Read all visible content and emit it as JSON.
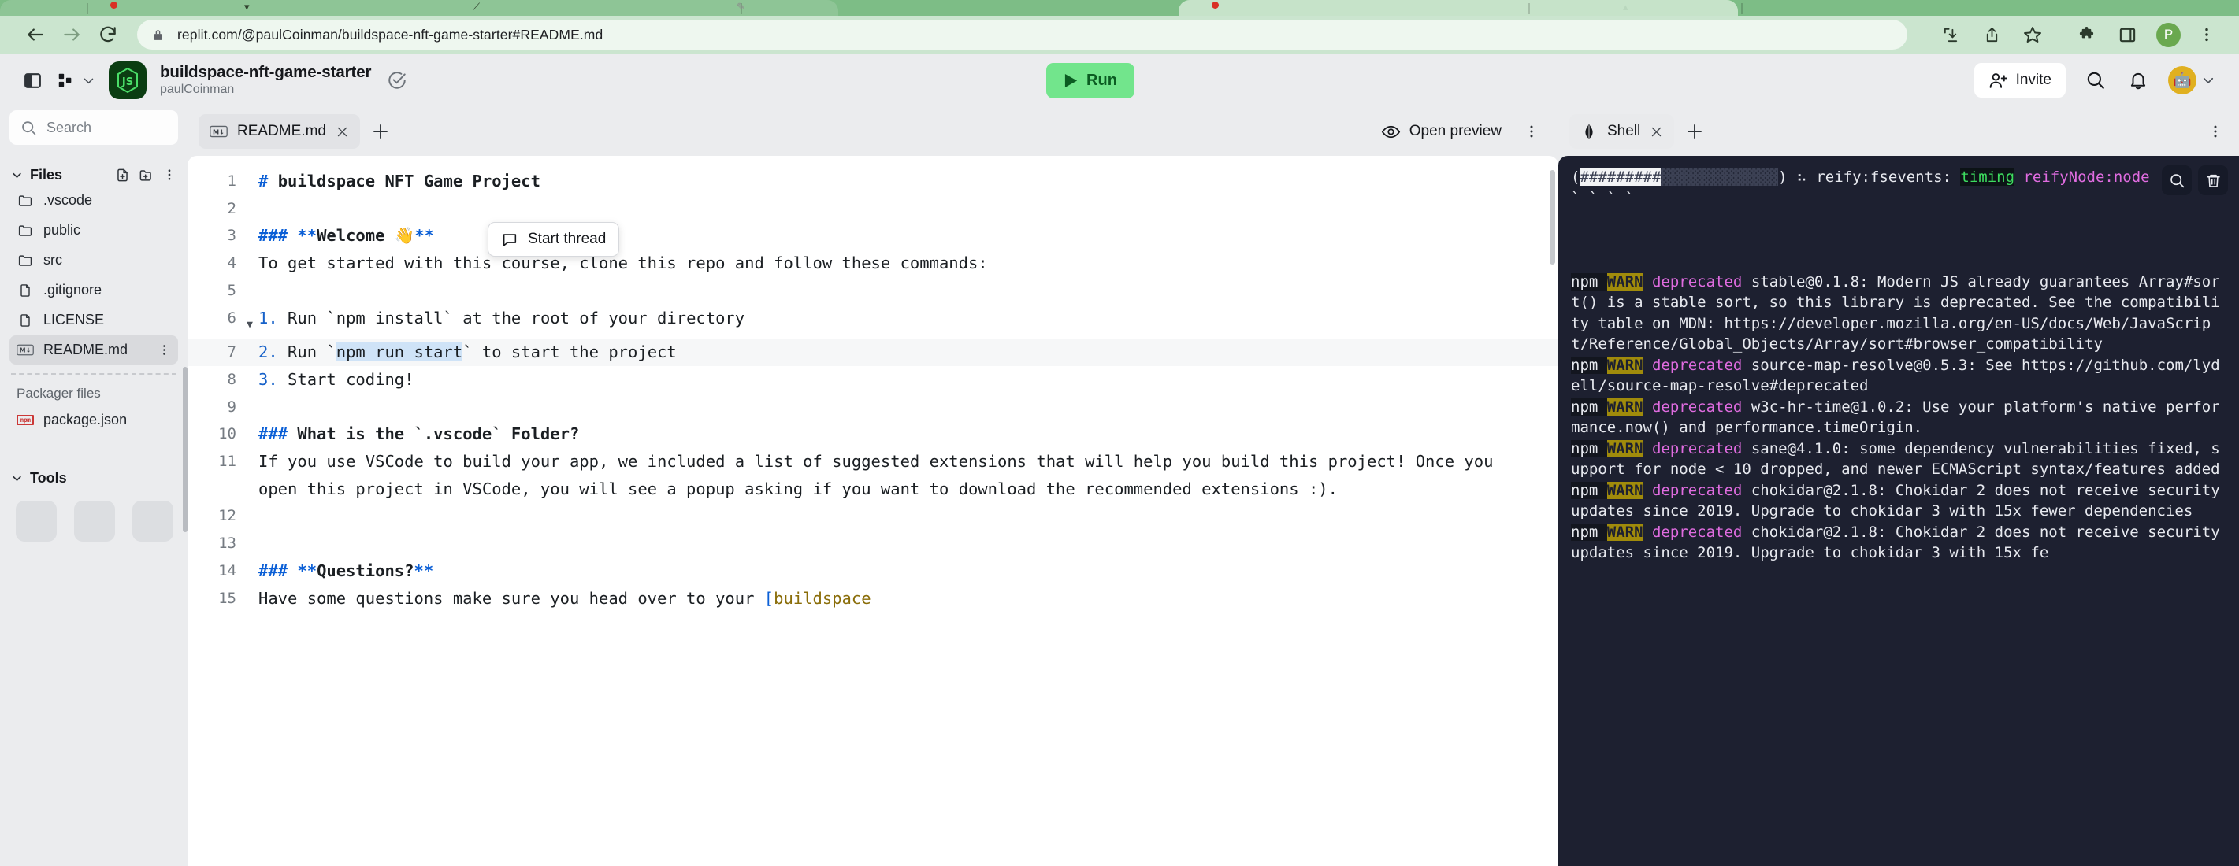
{
  "browser": {
    "url": "replit.com/@paulCoinman/buildspace-nft-game-starter#README.md",
    "nav": {
      "back": "back-arrow",
      "forward": "forward-arrow",
      "reload": "reload"
    },
    "toolbar_icons": [
      "install-icon",
      "share-icon",
      "bookmark-star-icon",
      "extensions-puzzle-icon",
      "side-panel-icon",
      "browser-menu-icon"
    ],
    "profile_initial": "P"
  },
  "header": {
    "project_title": "buildspace-nft-game-starter",
    "project_owner": "paulCoinman",
    "project_badge": "JS",
    "run_label": "Run",
    "invite_label": "Invite",
    "avatar_glyph": "🤖"
  },
  "sidebar": {
    "search_placeholder": "Search",
    "files_title": "Files",
    "files": [
      {
        "name": ".vscode",
        "type": "folder",
        "selected": false
      },
      {
        "name": "public",
        "type": "folder",
        "selected": false
      },
      {
        "name": "src",
        "type": "folder",
        "selected": false
      },
      {
        "name": ".gitignore",
        "type": "file",
        "selected": false
      },
      {
        "name": "LICENSE",
        "type": "file",
        "selected": false
      },
      {
        "name": "README.md",
        "type": "markdown",
        "selected": true
      }
    ],
    "packager_title": "Packager files",
    "packager_files": [
      {
        "name": "package.json",
        "type": "npm"
      }
    ],
    "tools_title": "Tools"
  },
  "editor": {
    "tab_label": "README.md",
    "tab_icon": "markdown-icon",
    "open_preview_label": "Open preview",
    "start_thread_label": "Start thread",
    "lines": [
      {
        "n": "1",
        "fold": false,
        "active": false,
        "segs": [
          {
            "t": "# ",
            "c": "md-hash"
          },
          {
            "t": "buildspace NFT Game Project",
            "c": "md-strong"
          }
        ]
      },
      {
        "n": "2",
        "fold": false,
        "active": false,
        "segs": []
      },
      {
        "n": "3",
        "fold": false,
        "active": false,
        "segs": [
          {
            "t": "### ",
            "c": "md-hash"
          },
          {
            "t": "**",
            "c": "md-star"
          },
          {
            "t": "Welcome ",
            "c": "md-strong"
          },
          {
            "t": "👋",
            "c": ""
          },
          {
            "t": "**",
            "c": "md-star"
          }
        ]
      },
      {
        "n": "4",
        "fold": false,
        "active": false,
        "segs": [
          {
            "t": "To get started with this course, clone this repo and follow these commands:",
            "c": ""
          }
        ]
      },
      {
        "n": "5",
        "fold": false,
        "active": false,
        "segs": []
      },
      {
        "n": "6",
        "fold": true,
        "active": false,
        "segs": [
          {
            "t": "1.",
            "c": "md-num"
          },
          {
            "t": " Run ",
            "c": ""
          },
          {
            "t": "`npm install`",
            "c": "md-tick"
          },
          {
            "t": " at the root of your directory",
            "c": ""
          }
        ]
      },
      {
        "n": "7",
        "fold": false,
        "active": true,
        "segs": [
          {
            "t": "2.",
            "c": "md-num"
          },
          {
            "t": " Run ",
            "c": ""
          },
          {
            "t": "`",
            "c": "md-tick"
          },
          {
            "t": "npm run start",
            "c": "sel"
          },
          {
            "t": "`",
            "c": "md-tick"
          },
          {
            "t": " to start the project",
            "c": ""
          }
        ]
      },
      {
        "n": "8",
        "fold": false,
        "active": false,
        "segs": [
          {
            "t": "3.",
            "c": "md-num"
          },
          {
            "t": " Start coding!",
            "c": ""
          }
        ]
      },
      {
        "n": "9",
        "fold": false,
        "active": false,
        "segs": []
      },
      {
        "n": "10",
        "fold": false,
        "active": false,
        "segs": [
          {
            "t": "### ",
            "c": "md-hash"
          },
          {
            "t": "What is the `.vscode` Folder?",
            "c": "md-strong"
          }
        ]
      },
      {
        "n": "11",
        "fold": false,
        "active": false,
        "segs": [
          {
            "t": "If you use VSCode to build your app, we included a list of suggested extensions that will help you build this project! Once you open this project in VSCode, you will see a popup asking if you want to download the recommended extensions :).",
            "c": ""
          }
        ]
      },
      {
        "n": "12",
        "fold": false,
        "active": false,
        "segs": []
      },
      {
        "n": "13",
        "fold": false,
        "active": false,
        "segs": []
      },
      {
        "n": "14",
        "fold": false,
        "active": false,
        "segs": [
          {
            "t": "### ",
            "c": "md-hash"
          },
          {
            "t": "**",
            "c": "md-star"
          },
          {
            "t": "Questions?",
            "c": "md-strong"
          },
          {
            "t": "**",
            "c": "md-star"
          }
        ]
      },
      {
        "n": "15",
        "fold": false,
        "active": false,
        "segs": [
          {
            "t": "Have some questions make sure you head over to your ",
            "c": ""
          },
          {
            "t": "[",
            "c": "md-bracket"
          },
          {
            "t": "buildspace",
            "c": "md-link"
          }
        ]
      }
    ]
  },
  "console": {
    "tab_label": "Shell",
    "tab_icon": "shell-icon",
    "lines": [
      {
        "segs": [
          {
            "t": "(",
            "c": ""
          },
          {
            "t": "#########",
            "c": "t-bar-fill"
          },
          {
            "t": "░░░░░░░░░░░░░",
            "c": "t-bar-empty"
          },
          {
            "t": ") ⠦ reify:fsevents: ",
            "c": ""
          },
          {
            "t": "timing",
            "c": "t-green"
          },
          {
            "t": " reifyNode:node",
            "c": "t-magenta"
          }
        ]
      },
      {
        "segs": [
          {
            "t": "` ` ` `",
            "c": ""
          }
        ]
      },
      {
        "segs": []
      },
      {
        "segs": []
      },
      {
        "segs": []
      },
      {
        "segs": [
          {
            "t": "npm ",
            "c": "t-npm"
          },
          {
            "t": "WARN",
            "c": "t-warn"
          },
          {
            "t": " ",
            "c": ""
          },
          {
            "t": "deprecated",
            "c": "t-dep"
          },
          {
            "t": " stable@0.1.8: Modern JS already guarantees Array#sort() is a stable sort, so this library is deprecated. See the compatibility table on MDN: https://developer.mozilla.org/en-US/docs/Web/JavaScript/Reference/Global_Objects/Array/sort#browser_compatibility",
            "c": ""
          }
        ]
      },
      {
        "segs": [
          {
            "t": "npm ",
            "c": "t-npm"
          },
          {
            "t": "WARN",
            "c": "t-warn"
          },
          {
            "t": " ",
            "c": ""
          },
          {
            "t": "deprecated",
            "c": "t-dep"
          },
          {
            "t": " source-map-resolve@0.5.3: See https://github.com/lydell/source-map-resolve#deprecated",
            "c": ""
          }
        ]
      },
      {
        "segs": [
          {
            "t": "npm ",
            "c": "t-npm"
          },
          {
            "t": "WARN",
            "c": "t-warn"
          },
          {
            "t": " ",
            "c": ""
          },
          {
            "t": "deprecated",
            "c": "t-dep"
          },
          {
            "t": " w3c-hr-time@1.0.2: Use your platform's native performance.now() and performance.timeOrigin.",
            "c": ""
          }
        ]
      },
      {
        "segs": [
          {
            "t": "npm ",
            "c": "t-npm"
          },
          {
            "t": "WARN",
            "c": "t-warn"
          },
          {
            "t": " ",
            "c": ""
          },
          {
            "t": "deprecated",
            "c": "t-dep"
          },
          {
            "t": " sane@4.1.0: some dependency vulnerabilities fixed, support for node < 10 dropped, and newer ECMAScript syntax/features added",
            "c": ""
          }
        ]
      },
      {
        "segs": [
          {
            "t": "npm ",
            "c": "t-npm"
          },
          {
            "t": "WARN",
            "c": "t-warn"
          },
          {
            "t": " ",
            "c": ""
          },
          {
            "t": "deprecated",
            "c": "t-dep"
          },
          {
            "t": " chokidar@2.1.8: Chokidar 2 does not receive security updates since 2019. Upgrade to chokidar 3 with 15x fewer dependencies",
            "c": ""
          }
        ]
      },
      {
        "segs": [
          {
            "t": "npm ",
            "c": "t-npm"
          },
          {
            "t": "WARN",
            "c": "t-warn"
          },
          {
            "t": " ",
            "c": ""
          },
          {
            "t": "deprecated",
            "c": "t-dep"
          },
          {
            "t": " chokidar@2.1.8: Chokidar 2 does not receive security updates since 2019. Upgrade to chokidar 3 with 15x fe",
            "c": ""
          }
        ]
      }
    ],
    "tools": [
      "search-icon",
      "trash-icon"
    ]
  },
  "colors": {
    "browser_green": "#7dbd86",
    "toolbar_green": "#cbe5cf",
    "run_green": "#72e58c",
    "terminal_bg": "#1d2030",
    "warn_bg": "#a08b0b",
    "magenta": "#e06ce0",
    "npm_red": "#cb3837"
  }
}
